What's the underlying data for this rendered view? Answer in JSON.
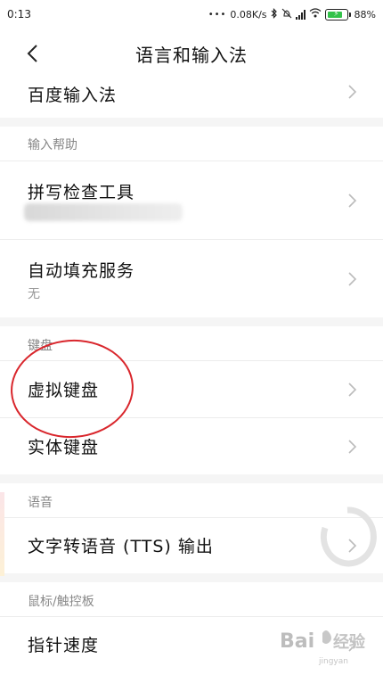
{
  "status_bar": {
    "time": "0:13",
    "dots": "•••",
    "speed": "0.08K/s",
    "battery_percent": "88%",
    "battery_level": 0.88
  },
  "header": {
    "title": "语言和输入法"
  },
  "items": {
    "baidu_ime": "百度输入法",
    "spell_checker": "拼写检查工具",
    "autofill": "自动填充服务",
    "autofill_value": "无",
    "virtual_keyboard": "虚拟键盘",
    "physical_keyboard": "实体键盘",
    "tts_output": "文字转语音 (TTS) 输出",
    "pointer_speed": "指针速度"
  },
  "sections": {
    "input_help": "输入帮助",
    "keyboard": "键盘",
    "voice": "语音",
    "mouse_touchpad": "鼠标/触控板"
  },
  "watermark": {
    "text": "Bai",
    "sub": "jingyan"
  },
  "colors": {
    "accent_circle": "#d9262c",
    "section_gap": "#f5f5f5",
    "battery_green": "#33c24a"
  }
}
